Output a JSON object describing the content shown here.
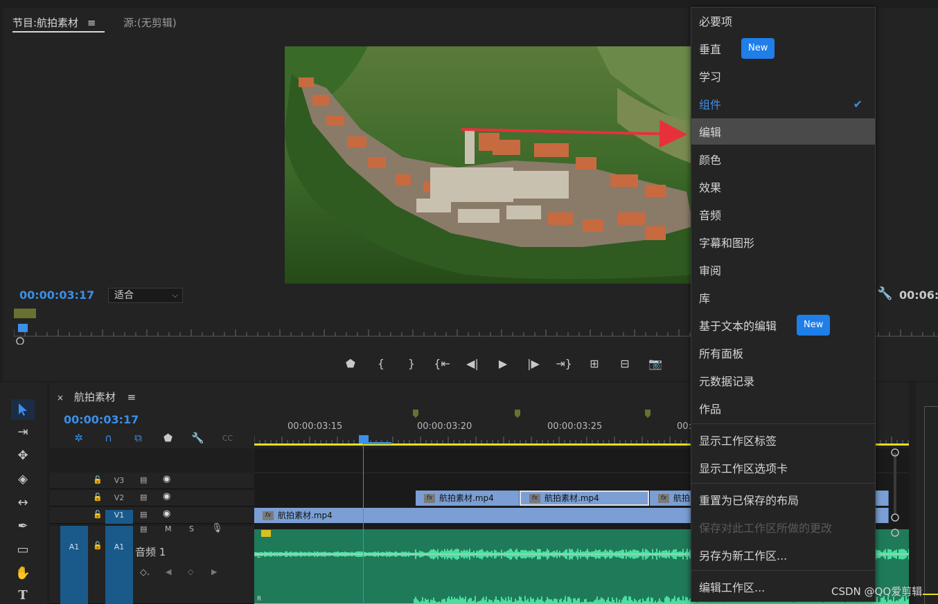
{
  "program_monitor": {
    "tab_label": "节目:航拍素材",
    "tab_menu_icon": "hamburger-icon",
    "source_tab_label": "源:(无剪辑)",
    "timecode": "00:00:03:17",
    "fit_value": "适合",
    "duration": "00:06:",
    "transport": [
      "marker-icon",
      "mark-in-icon",
      "mark-out-icon",
      "go-to-in-icon",
      "step-back-icon",
      "play-icon",
      "step-forward-icon",
      "go-to-out-icon",
      "insert-icon",
      "overwrite-icon",
      "export-frame-icon"
    ]
  },
  "timeline": {
    "tab_close": "×",
    "tab_label": "航拍素材",
    "timecode": "00:00:03:17",
    "ruler_labels": [
      "00:00:03:15",
      "00:00:03:20",
      "00:00:03:25",
      "00:"
    ],
    "tracks": {
      "v3": {
        "name": "V3"
      },
      "v2": {
        "name": "V2"
      },
      "v1": {
        "name": "V1",
        "source_patch": "V1"
      },
      "a1": {
        "patch": "A1",
        "name": "A1",
        "label": "音频 1",
        "m": "M",
        "s": "S"
      }
    },
    "clips": {
      "v2_1": "航拍素材.mp4",
      "v2_2": "航拍素材.mp4",
      "v2_3": "航拍",
      "v1": "航拍素材.mp4"
    },
    "audio_channels": [
      "L",
      "R"
    ],
    "fx_label": "fx"
  },
  "workspace_menu": {
    "items": [
      {
        "label": "必要项"
      },
      {
        "label": "垂直",
        "badge": "New"
      },
      {
        "label": "学习"
      },
      {
        "label": "组件",
        "selected": true
      },
      {
        "label": "编辑",
        "highlighted": true
      },
      {
        "label": "颜色"
      },
      {
        "label": "效果"
      },
      {
        "label": "音频"
      },
      {
        "label": "字幕和图形"
      },
      {
        "label": "审阅"
      },
      {
        "label": "库"
      },
      {
        "label": "基于文本的编辑",
        "badge": "New"
      },
      {
        "label": "所有面板"
      },
      {
        "label": "元数据记录"
      },
      {
        "label": "作品"
      },
      {
        "label": "显示工作区标签"
      },
      {
        "label": "显示工作区选项卡"
      },
      {
        "label": "重置为已保存的布局"
      },
      {
        "label": "保存对此工作区所做的更改",
        "disabled": true
      },
      {
        "label": "另存为新工作区..."
      },
      {
        "label": "编辑工作区..."
      }
    ]
  },
  "watermark": "CSDN @QQ爱剪辑",
  "colors": {
    "accent": "#3b8fe8",
    "clip": "#7b9fd4",
    "audio": "#1f7a5a",
    "badge": "#1f7ee8",
    "arrow": "#e8303a"
  }
}
